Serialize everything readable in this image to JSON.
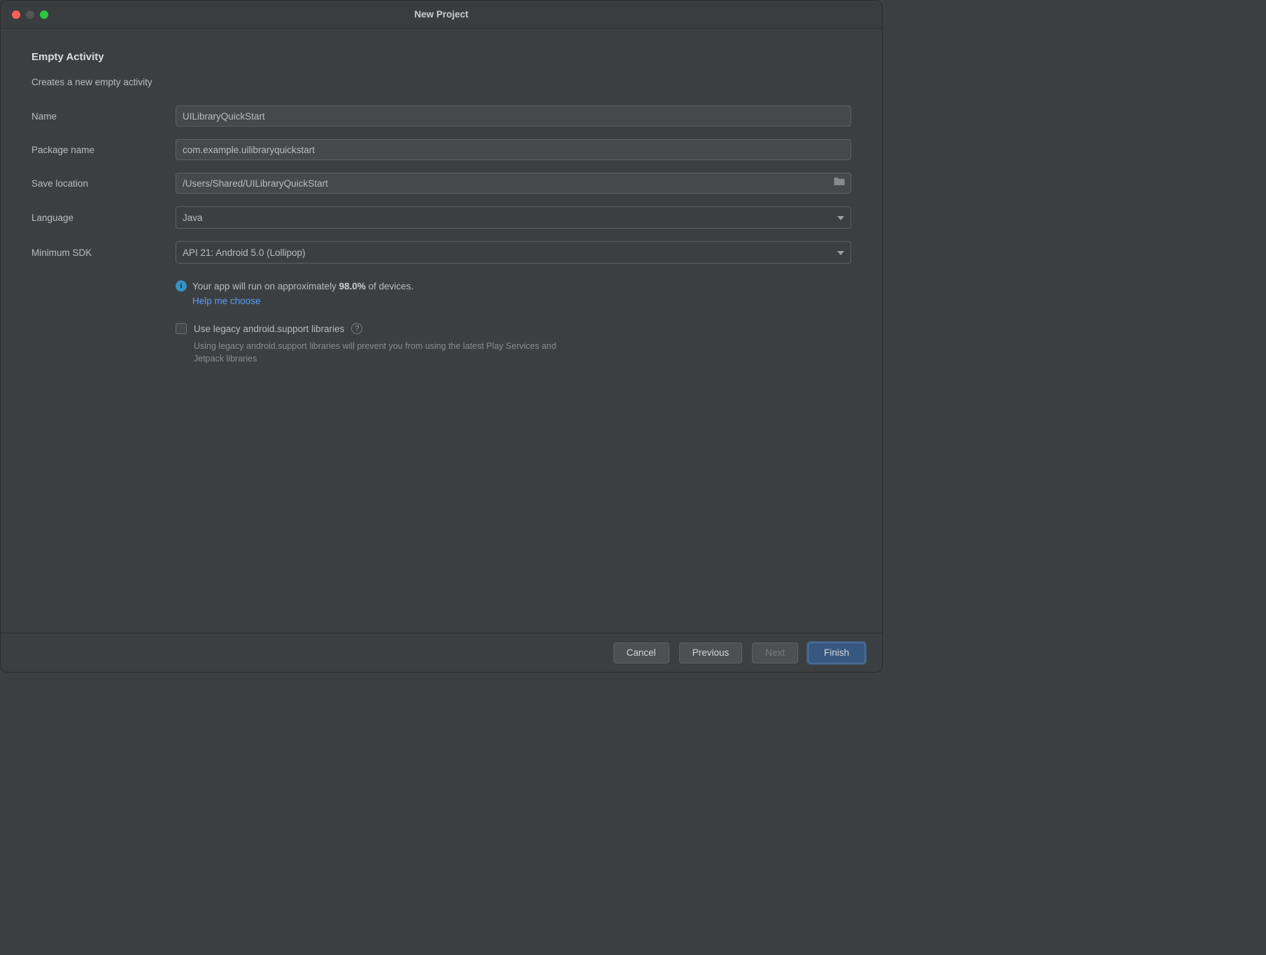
{
  "window": {
    "title": "New Project"
  },
  "heading": "Empty Activity",
  "subheading": "Creates a new empty activity",
  "fields": {
    "name": {
      "label": "Name",
      "value": "UILibraryQuickStart"
    },
    "packageName": {
      "label": "Package name",
      "value": "com.example.uilibraryquickstart"
    },
    "saveLocation": {
      "label": "Save location",
      "value": "/Users/Shared/UILibraryQuickStart"
    },
    "language": {
      "label": "Language",
      "value": "Java"
    },
    "minimumSdk": {
      "label": "Minimum SDK",
      "value": "API 21: Android 5.0 (Lollipop)"
    }
  },
  "info": {
    "prefix": "Your app will run on approximately ",
    "percent": "98.0%",
    "suffix": " of devices.",
    "helpLink": "Help me choose"
  },
  "legacy": {
    "label": "Use legacy android.support libraries",
    "helper": "Using legacy android.support libraries will prevent you from using the latest Play Services and Jetpack libraries"
  },
  "buttons": {
    "cancel": "Cancel",
    "previous": "Previous",
    "next": "Next",
    "finish": "Finish"
  }
}
